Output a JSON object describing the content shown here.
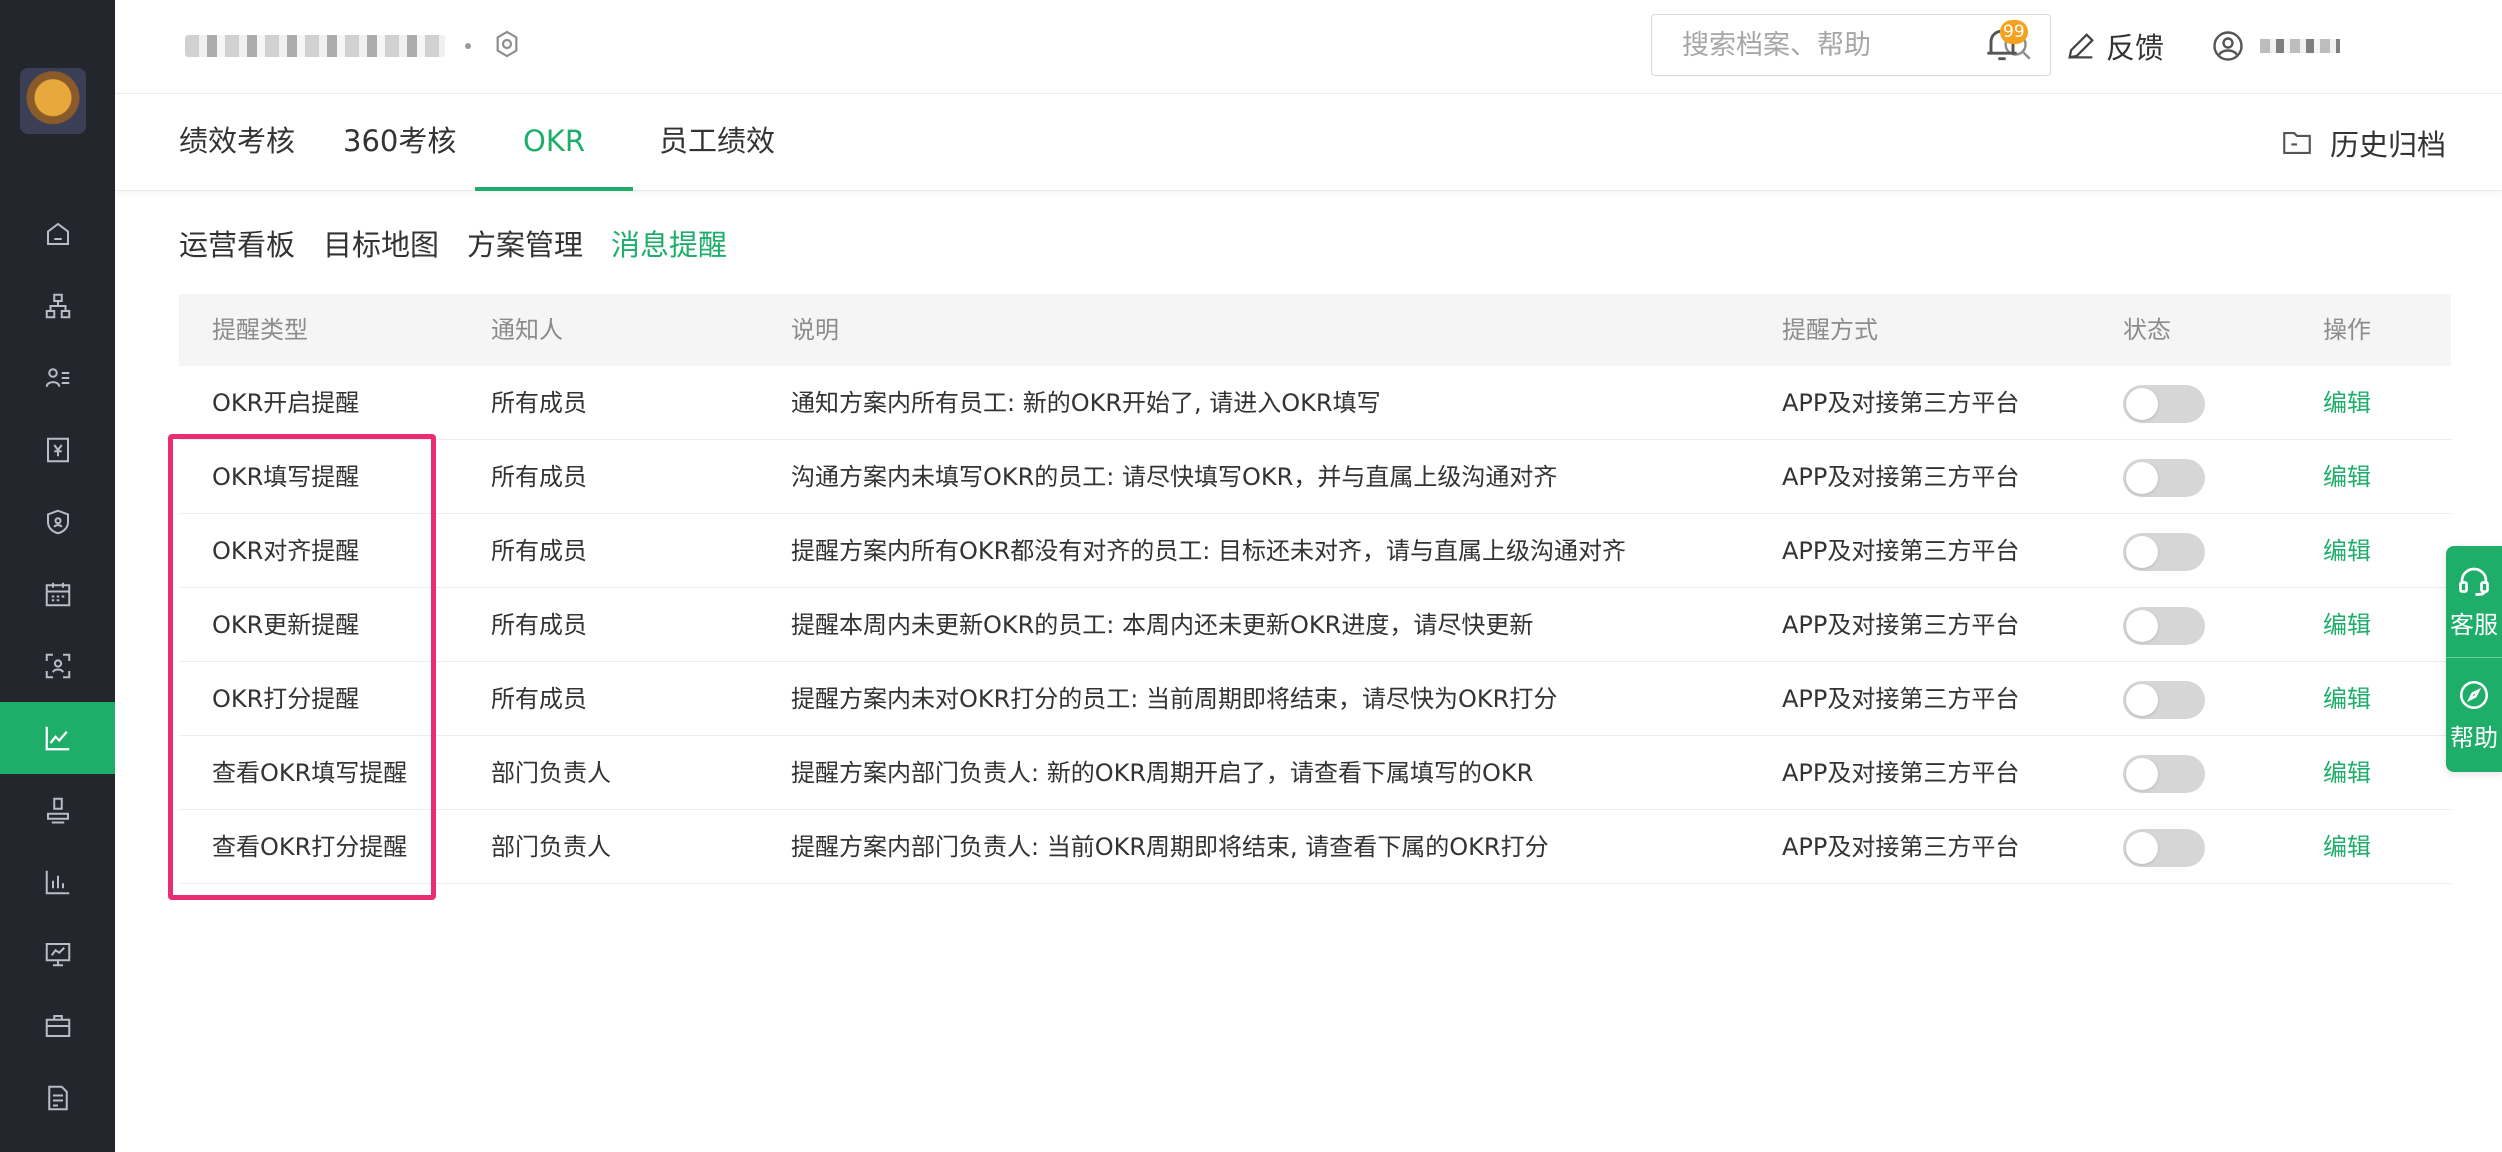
{
  "search": {
    "placeholder": "搜索档案、帮助"
  },
  "notifications": {
    "count": "99"
  },
  "header": {
    "feedback_label": "反馈"
  },
  "tabs": [
    {
      "label": "绩效考核"
    },
    {
      "label": "360考核"
    },
    {
      "label": "OKR"
    },
    {
      "label": "员工绩效"
    }
  ],
  "archive_label": "历史归档",
  "subtabs": [
    {
      "label": "运营看板"
    },
    {
      "label": "目标地图"
    },
    {
      "label": "方案管理"
    },
    {
      "label": "消息提醒"
    }
  ],
  "table": {
    "headers": [
      "提醒类型",
      "通知人",
      "说明",
      "提醒方式",
      "状态",
      "操作"
    ],
    "rows": [
      {
        "type": "OKR开启提醒",
        "recipient": "所有成员",
        "desc": "通知方案内所有员工: 新的OKR开始了, 请进入OKR填写",
        "method": "APP及对接第三方平台",
        "enabled": false,
        "action": "编辑"
      },
      {
        "type": "OKR填写提醒",
        "recipient": "所有成员",
        "desc": "沟通方案内未填写OKR的员工: 请尽快填写OKR，并与直属上级沟通对齐",
        "method": "APP及对接第三方平台",
        "enabled": false,
        "action": "编辑"
      },
      {
        "type": "OKR对齐提醒",
        "recipient": "所有成员",
        "desc": "提醒方案内所有OKR都没有对齐的员工: 目标还未对齐，请与直属上级沟通对齐",
        "method": "APP及对接第三方平台",
        "enabled": false,
        "action": "编辑"
      },
      {
        "type": "OKR更新提醒",
        "recipient": "所有成员",
        "desc": "提醒本周内未更新OKR的员工: 本周内还未更新OKR进度，请尽快更新",
        "method": "APP及对接第三方平台",
        "enabled": false,
        "action": "编辑"
      },
      {
        "type": "OKR打分提醒",
        "recipient": "所有成员",
        "desc": "提醒方案内未对OKR打分的员工: 当前周期即将结束，请尽快为OKR打分",
        "method": "APP及对接第三方平台",
        "enabled": false,
        "action": "编辑"
      },
      {
        "type": "查看OKR填写提醒",
        "recipient": "部门负责人",
        "desc": "提醒方案内部门负责人: 新的OKR周期开启了，请查看下属填写的OKR",
        "method": "APP及对接第三方平台",
        "enabled": false,
        "action": "编辑"
      },
      {
        "type": "查看OKR打分提醒",
        "recipient": "部门负责人",
        "desc": "提醒方案内部门负责人: 当前OKR周期即将结束, 请查看下属的OKR打分",
        "method": "APP及对接第三方平台",
        "enabled": false,
        "action": "编辑"
      }
    ]
  },
  "float_panel": {
    "service_label": "客服",
    "help_label": "帮助"
  },
  "colors": {
    "accent": "#1fae6a",
    "sidebar": "#24262e",
    "highlight": "#ea2c74",
    "badge": "#f4a21d"
  },
  "sidebar_icons": [
    "home-icon",
    "org-chart-icon",
    "employee-list-icon",
    "salary-icon",
    "security-icon",
    "calendar-icon",
    "scan-icon",
    "performance-icon",
    "approval-stamp-icon",
    "report-icon",
    "presentation-icon",
    "briefcase-icon",
    "document-icon"
  ]
}
